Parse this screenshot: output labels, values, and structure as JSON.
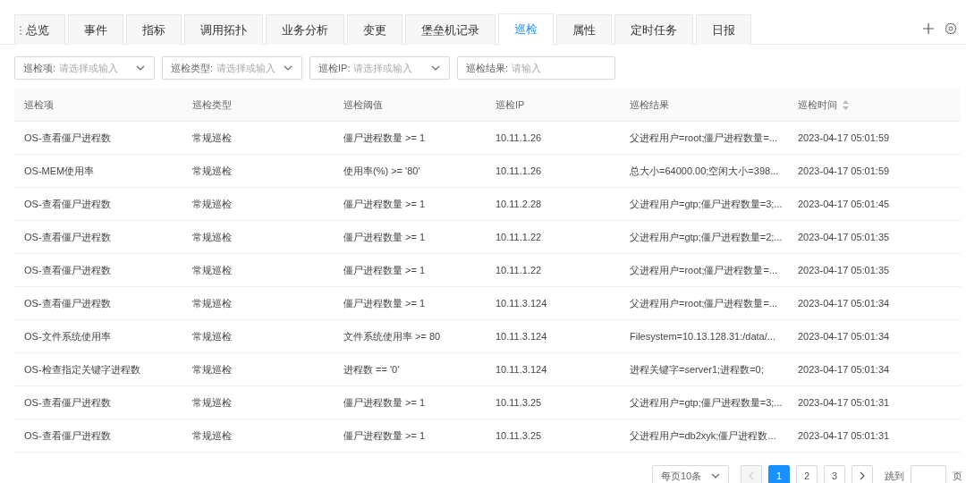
{
  "tabs": [
    {
      "label": "总览",
      "selected": false
    },
    {
      "label": "事件",
      "selected": false
    },
    {
      "label": "指标",
      "selected": false
    },
    {
      "label": "调用拓扑",
      "selected": false
    },
    {
      "label": "业务分析",
      "selected": false
    },
    {
      "label": "变更",
      "selected": false
    },
    {
      "label": "堡垒机记录",
      "selected": false
    },
    {
      "label": "巡检",
      "selected": true
    },
    {
      "label": "属性",
      "selected": false
    },
    {
      "label": "定时任务",
      "selected": false
    },
    {
      "label": "日报",
      "selected": false
    }
  ],
  "filters": [
    {
      "kind": "select",
      "label": "巡检项:",
      "placeholder": "请选择或输入"
    },
    {
      "kind": "select",
      "label": "巡检类型:",
      "placeholder": "请选择或输入"
    },
    {
      "kind": "select",
      "label": "巡检IP:",
      "placeholder": "请选择或输入"
    },
    {
      "kind": "input",
      "label": "巡检结果:",
      "placeholder": "请输入"
    }
  ],
  "table": {
    "columns": [
      {
        "label": "巡检项",
        "sortable": false
      },
      {
        "label": "巡检类型",
        "sortable": false
      },
      {
        "label": "巡检阈值",
        "sortable": false
      },
      {
        "label": "巡检IP",
        "sortable": false
      },
      {
        "label": "巡检结果",
        "sortable": false
      },
      {
        "label": "巡检时间",
        "sortable": true
      }
    ],
    "rows": [
      [
        "OS-查看僵尸进程数",
        "常规巡检",
        "僵尸进程数量 >= 1",
        "10.11.1.26",
        "父进程用户=root;僵尸进程数量=...",
        "2023-04-17 05:01:59"
      ],
      [
        "OS-MEM使用率",
        "常规巡检",
        "使用率(%) >= '80'",
        "10.11.1.26",
        "总大小=64000.00;空闲大小=398...",
        "2023-04-17 05:01:59"
      ],
      [
        "OS-查看僵尸进程数",
        "常规巡检",
        "僵尸进程数量 >= 1",
        "10.11.2.28",
        "父进程用户=gtp;僵尸进程数量=3;...",
        "2023-04-17 05:01:45"
      ],
      [
        "OS-查看僵尸进程数",
        "常规巡检",
        "僵尸进程数量 >= 1",
        "10.11.1.22",
        "父进程用户=gtp;僵尸进程数量=2;...",
        "2023-04-17 05:01:35"
      ],
      [
        "OS-查看僵尸进程数",
        "常规巡检",
        "僵尸进程数量 >= 1",
        "10.11.1.22",
        "父进程用户=root;僵尸进程数量=...",
        "2023-04-17 05:01:35"
      ],
      [
        "OS-查看僵尸进程数",
        "常规巡检",
        "僵尸进程数量 >= 1",
        "10.11.3.124",
        "父进程用户=root;僵尸进程数量=...",
        "2023-04-17 05:01:34"
      ],
      [
        "OS-文件系统使用率",
        "常规巡检",
        "文件系统使用率 >= 80",
        "10.11.3.124",
        "Filesystem=10.13.128.31:/data/...",
        "2023-04-17 05:01:34"
      ],
      [
        "OS-检查指定关键字进程数",
        "常规巡检",
        "进程数 == '0'",
        "10.11.3.124",
        "进程关键字=server1;进程数=0;",
        "2023-04-17 05:01:34"
      ],
      [
        "OS-查看僵尸进程数",
        "常规巡检",
        "僵尸进程数量 >= 1",
        "10.11.3.25",
        "父进程用户=gtp;僵尸进程数量=3;...",
        "2023-04-17 05:01:31"
      ],
      [
        "OS-查看僵尸进程数",
        "常规巡检",
        "僵尸进程数量 >= 1",
        "10.11.3.25",
        "父进程用户=db2xyk;僵尸进程数...",
        "2023-04-17 05:01:31"
      ]
    ]
  },
  "pagination": {
    "page_size": "每页10条",
    "prev_disabled": true,
    "next_disabled": false,
    "pages": [
      {
        "label": "1",
        "selected": true
      },
      {
        "label": "2",
        "selected": false
      },
      {
        "label": "3",
        "selected": false
      }
    ],
    "jump_label": "跳到",
    "page_suffix": "页"
  }
}
